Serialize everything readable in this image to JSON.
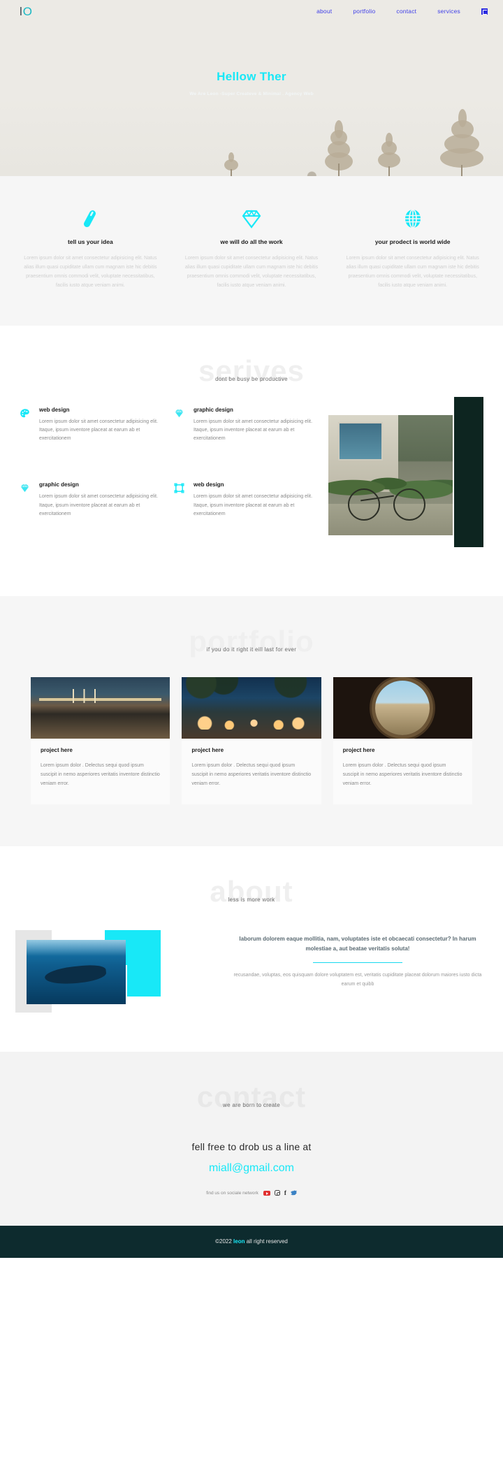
{
  "nav": {
    "logo_left": "l",
    "logo_right": "O",
    "links": [
      {
        "label": "about"
      },
      {
        "label": "portfolio"
      },
      {
        "label": "contact"
      },
      {
        "label": "services"
      }
    ],
    "toggle_icon": "menu-toggle-icon"
  },
  "hero": {
    "title": "Hellow Ther",
    "subtitle": "We Are Leon -Super Createve & Minimal . Agency Web",
    "title_color": "#18e8f7",
    "background_color": "#ebe9e4"
  },
  "features": [
    {
      "icon": "pen-icon",
      "title": "tell us your idea",
      "text": "Lorem ipsum dolor sit amet consectetur adipisicing elit. Natus alias illum quasi cupiditate ullam cum magnam iste hic debitis praesentium omnis commodi velit, voluptate necessitatibus, facilis iusto atque veniam animi."
    },
    {
      "icon": "diamond-icon",
      "title": "we will do all the work",
      "text": "Lorem ipsum dolor sit amet consectetur adipisicing elit. Natus alias illum quasi cupiditate ullam cum magnam iste hic debitis praesentium omnis commodi velit, voluptate necessitatibus, facilis iusto atque veniam animi."
    },
    {
      "icon": "globe-icon",
      "title": "your prodect is world wide",
      "text": "Lorem ipsum dolor sit amet consectetur adipisicing elit. Natus alias illum quasi cupiditate ullam cum magnam iste hic debitis praesentium omnis commodi velit, voluptate necessitatibus, facilis iusto atque veniam animi."
    }
  ],
  "services": {
    "big_heading": "serives",
    "sub_heading": "dont be busy be productive",
    "items": [
      {
        "icon": "palette-icon",
        "title": "web design",
        "text": "Lorem ipsum dolor sit amet consectetur adipisicing elit. Itaque, ipsum inventore placeat at earum ab et exercitationem"
      },
      {
        "icon": "diamond-icon",
        "title": "graphic design",
        "text": "Lorem ipsum dolor sit amet consectetur adipisicing elit. Itaque, ipsum inventore placeat at earum ab et exercitationem"
      },
      {
        "icon": "diamond-icon",
        "title": "graphic design",
        "text": "Lorem ipsum dolor sit amet consectetur adipisicing elit. Itaque, ipsum inventore placeat at earum ab et exercitationem"
      },
      {
        "icon": "frame-icon",
        "title": "web design",
        "text": "Lorem ipsum dolor sit amet consectetur adipisicing elit. Itaque, ipsum inventore placeat at earum ab et exercitationem"
      }
    ]
  },
  "portfolio": {
    "big_heading": "portfolio",
    "sub_heading": "if you do it right it eill last for ever",
    "cards": [
      {
        "image": "bridge-night-photo",
        "title": "project here",
        "text": "Lorem ipsum dolor . Delectus sequi quod ipsum suscipit in nemo asperiores veritatis inventore distinctio veniam error."
      },
      {
        "image": "beach-candles-photo",
        "title": "project here",
        "text": "Lorem ipsum dolor . Delectus sequi quod ipsum suscipit in nemo asperiores veritatis inventore distinctio veniam error."
      },
      {
        "image": "tunnel-porthole-photo",
        "title": "project here",
        "text": "Lorem ipsum dolor . Delectus sequi quod ipsum suscipit in nemo asperiores veritatis inventore distinctio veniam error."
      }
    ]
  },
  "about": {
    "big_heading": "about",
    "sub_heading": "less is more work",
    "image": "whale-underwater-photo",
    "lead": "laborum dolorem eaque mollitia, nam, voluptates iste et obcaecati consectetur? In harum molestiae a, aut beatae veritatis soluta!",
    "body": "recusandae, voluptas, eos quisquam dolore voluptatem est, veritatis cupiditate placeat dolorum maiores iusto dicta earum et quibb",
    "accent_color": "#18e8f7"
  },
  "contact": {
    "big_heading": "contact",
    "sub_heading": "we are born to create",
    "line": "fell free to drob us a line at",
    "email": "miall@gmail.com",
    "social_label": "find us on sociale network",
    "socials": [
      {
        "name": "youtube-icon"
      },
      {
        "name": "instagram-icon"
      },
      {
        "name": "facebook-icon"
      },
      {
        "name": "twitter-icon"
      }
    ]
  },
  "footer": {
    "prefix": "©2022 ",
    "brand": "leon",
    "suffix": " all right reserved"
  }
}
